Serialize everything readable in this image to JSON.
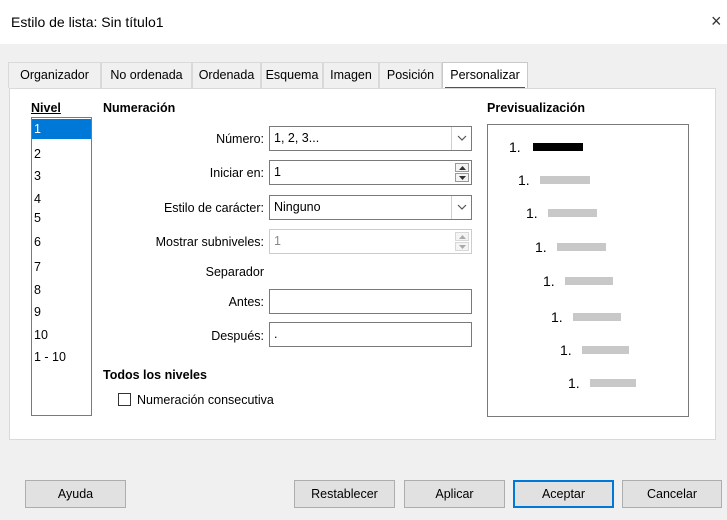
{
  "window": {
    "title": "Estilo de lista: Sin título1",
    "close_icon": "×"
  },
  "tabs": [
    {
      "label": "Organizador"
    },
    {
      "label": "No ordenada"
    },
    {
      "label": "Ordenada"
    },
    {
      "label": "Esquema"
    },
    {
      "label": "Imagen"
    },
    {
      "label": "Posición"
    },
    {
      "label": "Personalizar",
      "active": true
    }
  ],
  "level": {
    "header": "Nivel",
    "items": [
      "1",
      "2",
      "3",
      "4",
      "5",
      "6",
      "7",
      "8",
      "9",
      "10",
      "1 - 10"
    ],
    "selected": "1"
  },
  "numbering": {
    "header": "Numeración",
    "number_label": "Número:",
    "number_value": "1, 2, 3...",
    "start_label": "Iniciar en:",
    "start_value": "1",
    "char_style_label": "Estilo de carácter:",
    "char_style_value": "Ninguno",
    "show_sublevels_label": "Mostrar subniveles:",
    "show_sublevels_value": "1",
    "separator_label": "Separador",
    "before_label": "Antes:",
    "before_value": "",
    "after_label": "Después:",
    "after_value": "."
  },
  "all_levels": {
    "header": "Todos los niveles",
    "consecutive_label": "Numeración consecutiva",
    "consecutive_checked": false
  },
  "preview": {
    "header": "Previsualización",
    "rows": [
      {
        "num": "1.",
        "highlight": true
      },
      {
        "num": "1.",
        "highlight": false
      },
      {
        "num": "1.",
        "highlight": false
      },
      {
        "num": "1.",
        "highlight": false
      },
      {
        "num": "1.",
        "highlight": false
      },
      {
        "num": "1.",
        "highlight": false
      },
      {
        "num": "1.",
        "highlight": false
      },
      {
        "num": "1.",
        "highlight": false
      }
    ],
    "highlight_color": "#000000",
    "bar_color": "#c8c8c8"
  },
  "buttons": {
    "help": "Ayuda",
    "reset": "Restablecer",
    "apply": "Aplicar",
    "ok": "Aceptar",
    "cancel": "Cancelar"
  },
  "colors": {
    "accent": "#0078d7",
    "active_tab_indicator": "#e81123"
  }
}
